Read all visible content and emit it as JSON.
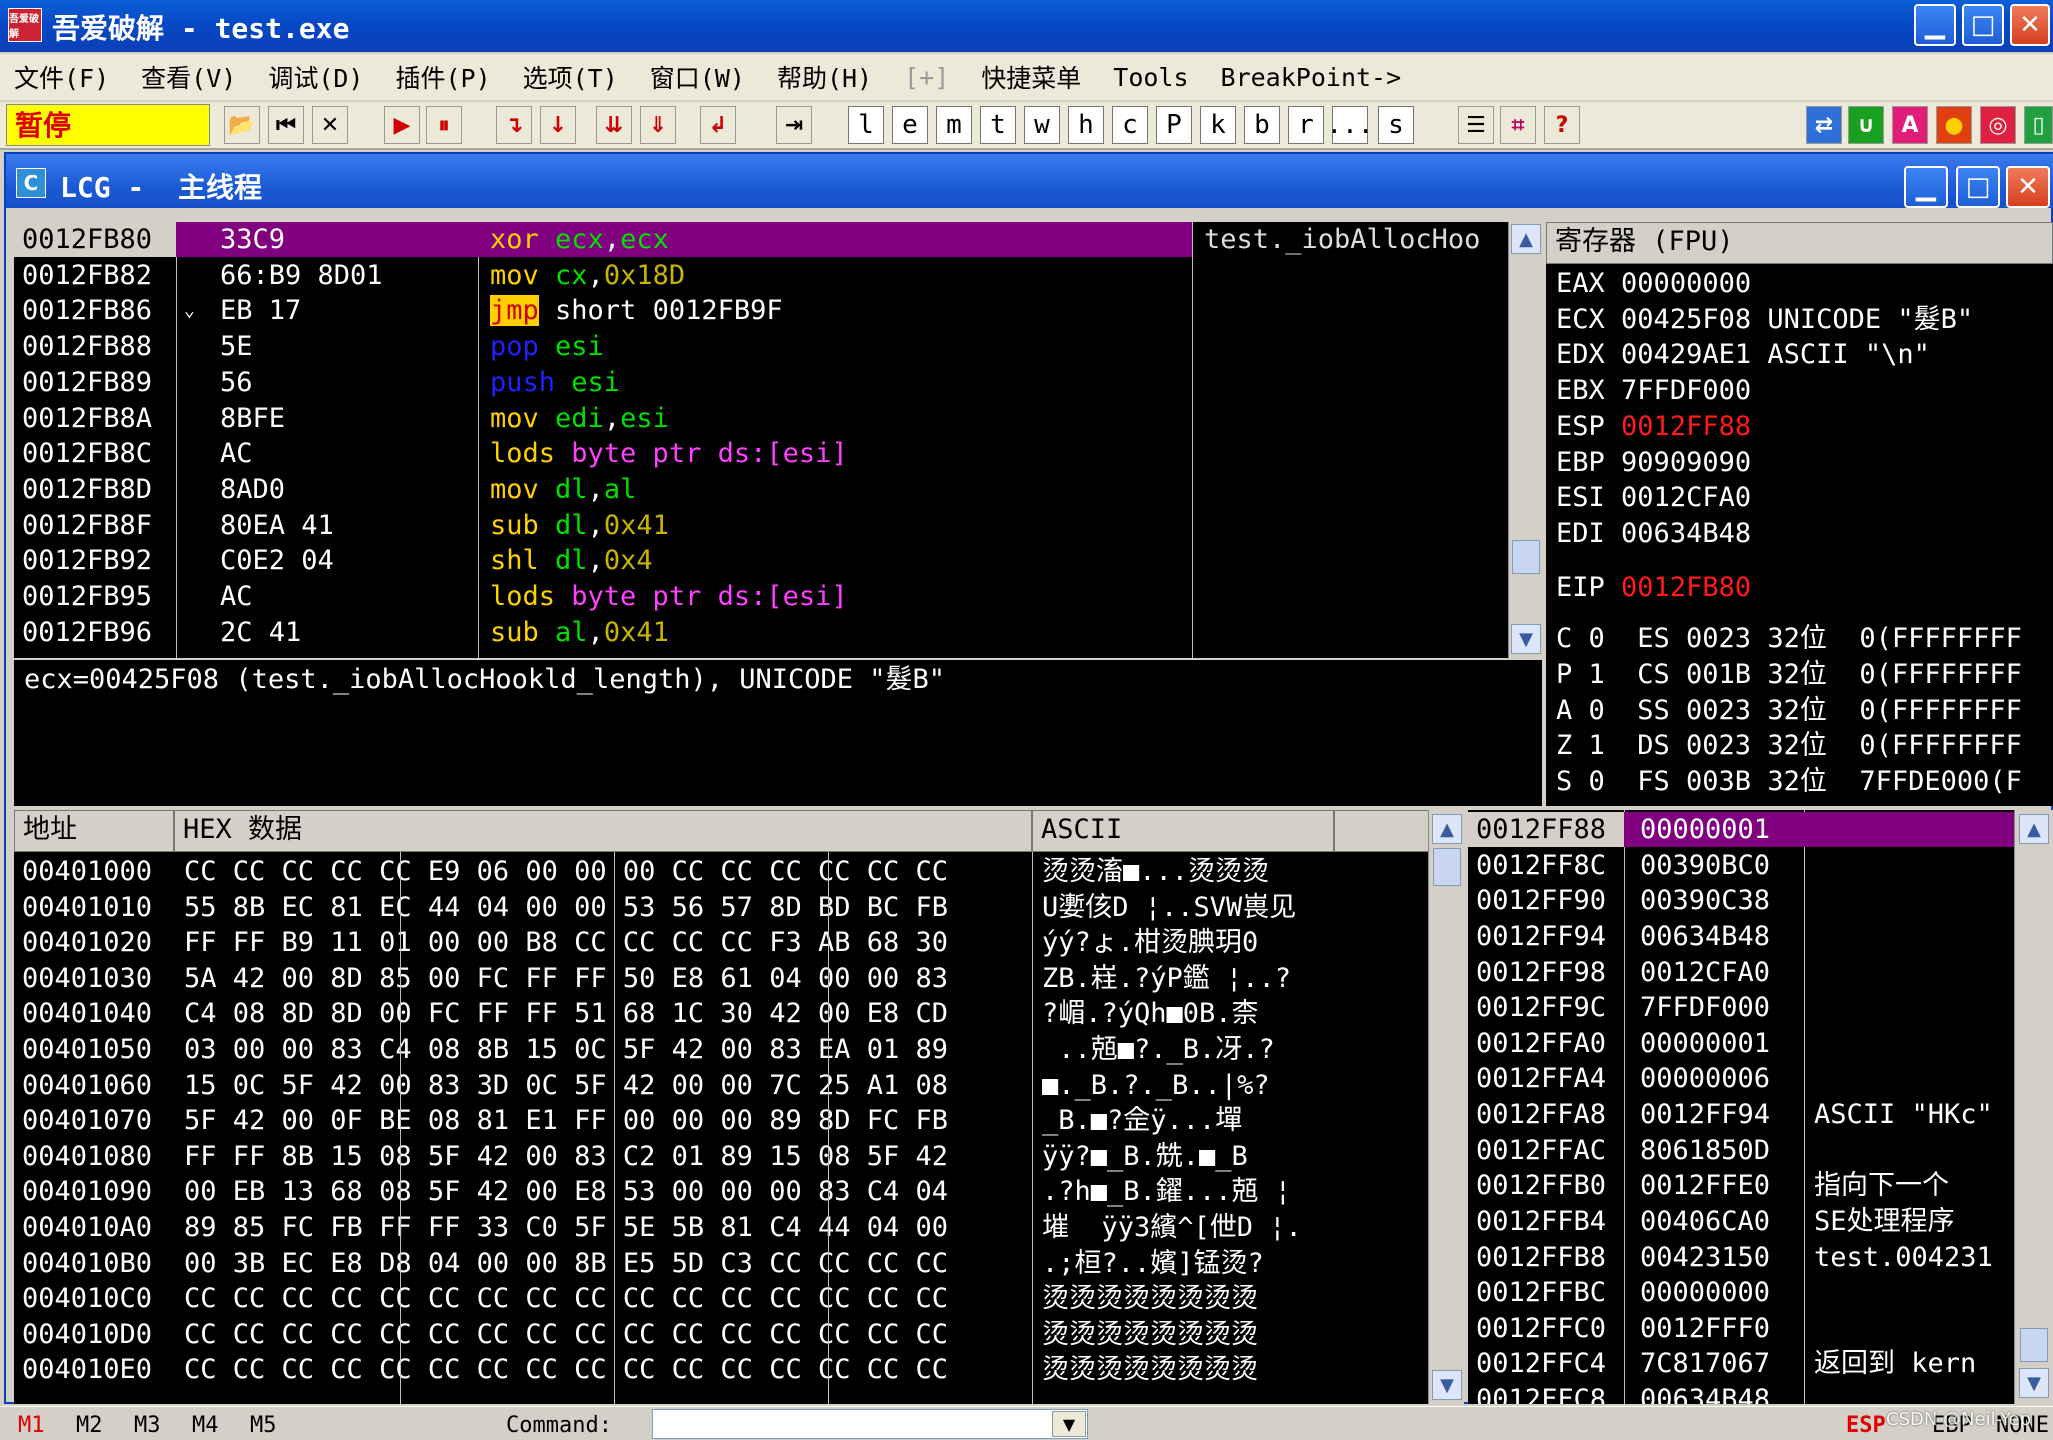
{
  "window": {
    "title": "吾爱破解 - test.exe",
    "icon_text": "吾爱破解",
    "min": "▁",
    "max": "□",
    "close": "✕"
  },
  "menu": [
    {
      "label": "文件(F)",
      "dis": false
    },
    {
      "label": "查看(V)",
      "dis": false
    },
    {
      "label": "调试(D)",
      "dis": false
    },
    {
      "label": "插件(P)",
      "dis": false
    },
    {
      "label": "选项(T)",
      "dis": false
    },
    {
      "label": "窗口(W)",
      "dis": false
    },
    {
      "label": "帮助(H)",
      "dis": false
    },
    {
      "label": "[+]",
      "dis": true
    },
    {
      "label": "快捷菜单",
      "dis": false
    },
    {
      "label": "Tools",
      "dis": false
    },
    {
      "label": "BreakPoint->",
      "dis": false
    }
  ],
  "toolbar": {
    "status": "暂停",
    "letters": [
      "l",
      "e",
      "m",
      "t",
      "w",
      "h",
      "c",
      "P",
      "k",
      "b",
      "r",
      "...",
      "s"
    ]
  },
  "child": {
    "title": "LCG -  主线程",
    "icon": "C"
  },
  "disasm": {
    "comment_header": "test._iobAllocHoo",
    "rows": [
      {
        "addr": "0012FB80",
        "arrow": "",
        "hex": "33C9",
        "asm": [
          [
            "xor ",
            "y"
          ],
          [
            "ecx",
            "g"
          ],
          [
            ",",
            "w"
          ],
          [
            "ecx",
            "g"
          ]
        ],
        "sel": true
      },
      {
        "addr": "0012FB82",
        "arrow": "",
        "hex": "66:B9 8D01",
        "asm": [
          [
            "mov ",
            "y"
          ],
          [
            "cx",
            "g"
          ],
          [
            ",",
            "w"
          ],
          [
            "0x18D",
            "ol"
          ]
        ]
      },
      {
        "addr": "0012FB86",
        "arrow": "⌄",
        "hex": "EB 17",
        "asm": [
          [
            "jmp",
            "jmp"
          ],
          [
            " short 0012FB9F",
            "w"
          ]
        ]
      },
      {
        "addr": "0012FB88",
        "arrow": "",
        "hex": "5E",
        "asm": [
          [
            "pop ",
            "bl"
          ],
          [
            "esi",
            "g"
          ]
        ]
      },
      {
        "addr": "0012FB89",
        "arrow": "",
        "hex": "56",
        "asm": [
          [
            "push ",
            "bl"
          ],
          [
            "esi",
            "g"
          ]
        ]
      },
      {
        "addr": "0012FB8A",
        "arrow": "",
        "hex": "8BFE",
        "asm": [
          [
            "mov ",
            "y"
          ],
          [
            "edi",
            "g"
          ],
          [
            ",",
            "w"
          ],
          [
            "esi",
            "g"
          ]
        ]
      },
      {
        "addr": "0012FB8C",
        "arrow": "",
        "hex": "AC",
        "asm": [
          [
            "lods ",
            "y"
          ],
          [
            "byte ptr ds:[esi]",
            "m"
          ]
        ]
      },
      {
        "addr": "0012FB8D",
        "arrow": "",
        "hex": "8AD0",
        "asm": [
          [
            "mov ",
            "y"
          ],
          [
            "dl",
            "g"
          ],
          [
            ",",
            "w"
          ],
          [
            "al",
            "g"
          ]
        ]
      },
      {
        "addr": "0012FB8F",
        "arrow": "",
        "hex": "80EA 41",
        "asm": [
          [
            "sub ",
            "y"
          ],
          [
            "dl",
            "g"
          ],
          [
            ",",
            "w"
          ],
          [
            "0x41",
            "ol"
          ]
        ]
      },
      {
        "addr": "0012FB92",
        "arrow": "",
        "hex": "C0E2 04",
        "asm": [
          [
            "shl ",
            "y"
          ],
          [
            "dl",
            "g"
          ],
          [
            ",",
            "w"
          ],
          [
            "0x4",
            "ol"
          ]
        ]
      },
      {
        "addr": "0012FB95",
        "arrow": "",
        "hex": "AC",
        "asm": [
          [
            "lods ",
            "y"
          ],
          [
            "byte ptr ds:[esi]",
            "m"
          ]
        ]
      },
      {
        "addr": "0012FB96",
        "arrow": "",
        "hex": "2C 41",
        "asm": [
          [
            "sub ",
            "y"
          ],
          [
            "al",
            "g"
          ],
          [
            ",",
            "w"
          ],
          [
            "0x41",
            "ol"
          ]
        ]
      }
    ],
    "info": "ecx=00425F08 (test._iobAllocHookld_length), UNICODE \"髮B\""
  },
  "registers": {
    "header": "寄存器 (FPU)",
    "rows": [
      {
        "name": "EAX",
        "val": "00000000",
        "note": "",
        "red": false
      },
      {
        "name": "ECX",
        "val": "00425F08",
        "note": "UNICODE \"髮B\"",
        "red": false
      },
      {
        "name": "EDX",
        "val": "00429AE1",
        "note": "ASCII \"\\n\"",
        "red": false
      },
      {
        "name": "EBX",
        "val": "7FFDF000",
        "note": "",
        "red": false
      },
      {
        "name": "ESP",
        "val": "0012FF88",
        "note": "",
        "red": true
      },
      {
        "name": "EBP",
        "val": "90909090",
        "note": "",
        "red": false
      },
      {
        "name": "ESI",
        "val": "0012CFA0",
        "note": "",
        "red": false
      },
      {
        "name": "EDI",
        "val": "00634B48",
        "note": "",
        "red": false
      }
    ],
    "eip": {
      "name": "EIP",
      "val": "0012FB80"
    },
    "flags": [
      "C 0  ES 0023 32位  0(FFFFFFFF",
      "P 1  CS 001B 32位  0(FFFFFFFF",
      "A 0  SS 0023 32位  0(FFFFFFFF",
      "Z 1  DS 0023 32位  0(FFFFFFFF",
      "S 0  FS 003B 32位  7FFDE000(F"
    ]
  },
  "dump": {
    "h_addr": "地址",
    "h_hex": "HEX 数据",
    "h_ascii": "ASCII",
    "rows": [
      {
        "addr": "00401000",
        "hex": "CC CC CC CC CC E9 06 00 00 00 CC CC CC CC CC CC",
        "ascii": "烫烫滀■...烫烫烫"
      },
      {
        "addr": "00401010",
        "hex": "55 8B EC 81 EC 44 04 00 00 53 56 57 8D BD BC FB",
        "ascii": "U嬱侅D ¦..SVW嵔见"
      },
      {
        "addr": "00401020",
        "hex": "FF FF B9 11 01 00 00 B8 CC CC CC CC F3 AB 68 30",
        "ascii": "ýý?ょ.柑烫腆玥0"
      },
      {
        "addr": "00401030",
        "hex": "5A 42 00 8D 85 00 FC FF FF 50 E8 61 04 00 00 83",
        "ascii": "ZB.嵀.?ýP鑑 ¦..?"
      },
      {
        "addr": "00401040",
        "hex": "C4 08 8D 8D 00 FC FF FF 51 68 1C 30 42 00 E8 CD",
        "ascii": "?嵋.?ýQh■0B.柰"
      },
      {
        "addr": "00401050",
        "hex": "03 00 00 83 C4 08 8B 15 0C 5F 42 00 83 EA 01 89",
        "ascii": " ..兡■?._B.冴.?"
      },
      {
        "addr": "00401060",
        "hex": "15 0C 5F 42 00 83 3D 0C 5F 42 00 00 7C 25 A1 08",
        "ascii": "■._B.?._B..|%?"
      },
      {
        "addr": "00401070",
        "hex": "5F 42 00 0F BE 08 81 E1 FF 00 00 00 89 8D FC FB",
        "ascii": "_B.■?佱ÿ...墠"
      },
      {
        "addr": "00401080",
        "hex": "FF FF 8B 15 08 5F 42 00 83 C2 01 89 15 08 5F 42",
        "ascii": "ÿÿ?■_B.兟.■_B"
      },
      {
        "addr": "00401090",
        "hex": "00 EB 13 68 08 5F 42 00 E8 53 00 00 00 83 C4 04",
        "ascii": ".?h■_B.鑃...兡 ¦"
      },
      {
        "addr": "004010A0",
        "hex": "89 85 FC FB FF FF 33 C0 5F 5E 5B 81 C4 44 04 00",
        "ascii": "墔  ÿÿ3繽^[伳D ¦."
      },
      {
        "addr": "004010B0",
        "hex": "00 3B EC E8 D8 04 00 00 8B E5 5D C3 CC CC CC CC",
        "ascii": ".;桓?..嬪]锰烫?"
      },
      {
        "addr": "004010C0",
        "hex": "CC CC CC CC CC CC CC CC CC CC CC CC CC CC CC CC",
        "ascii": "烫烫烫烫烫烫烫烫"
      },
      {
        "addr": "004010D0",
        "hex": "CC CC CC CC CC CC CC CC CC CC CC CC CC CC CC CC",
        "ascii": "烫烫烫烫烫烫烫烫"
      },
      {
        "addr": "004010E0",
        "hex": "CC CC CC CC CC CC CC CC CC CC CC CC CC CC CC CC",
        "ascii": "烫烫烫烫烫烫烫烫"
      }
    ]
  },
  "stack": {
    "rows": [
      {
        "addr": "0012FF88",
        "val": "00000001",
        "note": "",
        "sel": true
      },
      {
        "addr": "0012FF8C",
        "val": "00390BC0",
        "note": ""
      },
      {
        "addr": "0012FF90",
        "val": "00390C38",
        "note": ""
      },
      {
        "addr": "0012FF94",
        "val": "00634B48",
        "note": ""
      },
      {
        "addr": "0012FF98",
        "val": "0012CFA0",
        "note": ""
      },
      {
        "addr": "0012FF9C",
        "val": "7FFDF000",
        "note": ""
      },
      {
        "addr": "0012FFA0",
        "val": "00000001",
        "note": ""
      },
      {
        "addr": "0012FFA4",
        "val": "00000006",
        "note": ""
      },
      {
        "addr": "0012FFA8",
        "val": "0012FF94",
        "note": "ASCII \"HKc\""
      },
      {
        "addr": "0012FFAC",
        "val": "8061850D",
        "note": ""
      },
      {
        "addr": "0012FFB0",
        "val": "0012FFE0",
        "note": "指向下一个"
      },
      {
        "addr": "0012FFB4",
        "val": "00406CA0",
        "note": "SE处理程序"
      },
      {
        "addr": "0012FFB8",
        "val": "00423150",
        "note": "test.004231"
      },
      {
        "addr": "0012FFBC",
        "val": "00000000",
        "note": ""
      },
      {
        "addr": "0012FFC0",
        "val": "0012FFF0",
        "note": ""
      },
      {
        "addr": "0012FFC4",
        "val": "7C817067",
        "note": "返回到 kern"
      },
      {
        "addr": "0012FFC8",
        "val": "00634B48",
        "note": ""
      }
    ]
  },
  "status": {
    "m": [
      "M1",
      "M2",
      "M3",
      "M4",
      "M5"
    ],
    "command_label": "Command:",
    "esp": "ESP",
    "ebp": "EBP",
    "none": "NONE",
    "watermark": "CSDN @Neil-Yep"
  }
}
